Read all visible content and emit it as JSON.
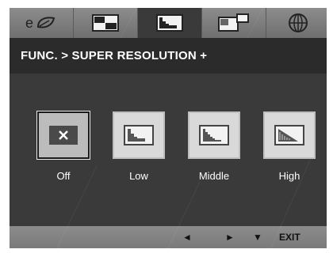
{
  "tabs": [
    {
      "icon": "eco-icon",
      "active": false
    },
    {
      "icon": "picture-icon",
      "active": false
    },
    {
      "icon": "super-resolution-icon",
      "active": true
    },
    {
      "icon": "pip-icon",
      "active": false
    },
    {
      "icon": "globe-icon",
      "active": false
    }
  ],
  "header": {
    "breadcrumb": "FUNC. > SUPER RESOLUTION +"
  },
  "options": [
    {
      "label": "Off",
      "icon": "close-icon",
      "selected": true
    },
    {
      "label": "Low",
      "icon": "resolution-low-icon",
      "selected": false
    },
    {
      "label": "Middle",
      "icon": "resolution-middle-icon",
      "selected": false
    },
    {
      "label": "High",
      "icon": "resolution-high-icon",
      "selected": false
    }
  ],
  "footer": {
    "left": "◄",
    "right": "►",
    "down": "▼",
    "exit": "EXIT"
  },
  "colors": {
    "panel": "#3a3a3a",
    "tabbar": "#8c8c8c",
    "titlebar": "#2b2b2b",
    "option_box": "#d9d9d9",
    "text": "#ffffff"
  }
}
